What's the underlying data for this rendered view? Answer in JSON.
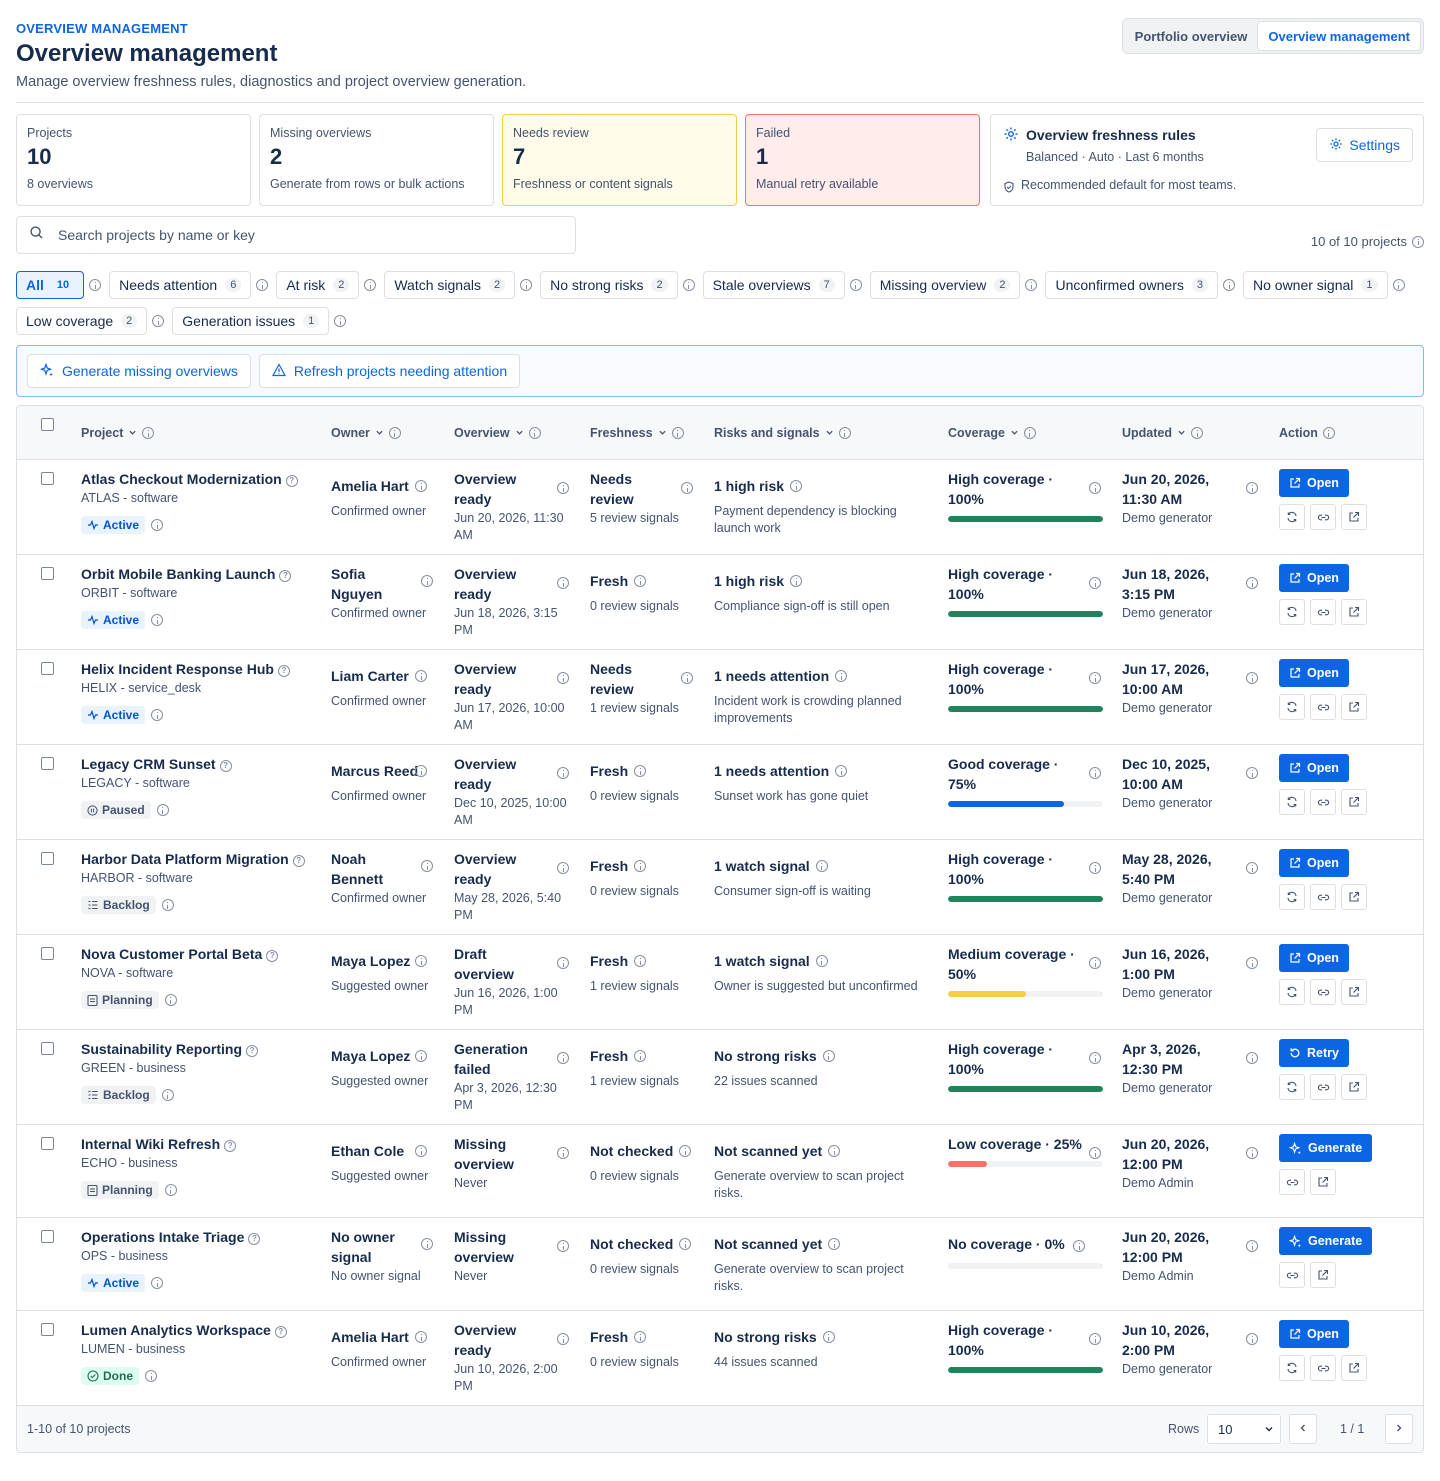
{
  "header": {
    "eyebrow": "OVERVIEW MANAGEMENT",
    "title": "Overview management",
    "subtitle": "Manage overview freshness rules, diagnostics and project overview generation.",
    "tabs": [
      "Portfolio overview",
      "Overview management"
    ],
    "active_tab": 1
  },
  "stats": [
    {
      "label": "Projects",
      "value": "10",
      "sub": "8 overviews"
    },
    {
      "label": "Missing overviews",
      "value": "2",
      "sub": "Generate from rows or bulk actions"
    },
    {
      "label": "Needs review",
      "value": "7",
      "sub": "Freshness or content signals"
    },
    {
      "label": "Failed",
      "value": "1",
      "sub": "Manual retry available"
    }
  ],
  "rules": {
    "title": "Overview freshness rules",
    "meta": "Balanced · Auto · Last 6 months",
    "note": "Recommended default for most teams.",
    "settings_label": "Settings"
  },
  "search": {
    "placeholder": "Search projects by name or key",
    "value": ""
  },
  "count_label": "10 of 10 projects",
  "filters": [
    {
      "label": "All",
      "count": "10"
    },
    {
      "label": "Needs attention",
      "count": "6"
    },
    {
      "label": "At risk",
      "count": "2"
    },
    {
      "label": "Watch signals",
      "count": "2"
    },
    {
      "label": "No strong risks",
      "count": "2"
    },
    {
      "label": "Stale overviews",
      "count": "7"
    },
    {
      "label": "Missing overview",
      "count": "2"
    },
    {
      "label": "Unconfirmed owners",
      "count": "3"
    },
    {
      "label": "No owner signal",
      "count": "1"
    },
    {
      "label": "Low coverage",
      "count": "2"
    },
    {
      "label": "Generation issues",
      "count": "1"
    }
  ],
  "bulk": {
    "generate_label": "Generate missing overviews",
    "refresh_label": "Refresh projects needing attention"
  },
  "columns": [
    "Project",
    "Owner",
    "Overview",
    "Freshness",
    "Risks and signals",
    "Coverage",
    "Updated",
    "Action"
  ],
  "rows": [
    {
      "name": "Atlas Checkout Modernization",
      "key": "ATLAS - software",
      "status": "Active",
      "owner": "Amelia Hart",
      "owner_sub": "Confirmed owner",
      "overview": "Overview ready",
      "overview_date": "Jun 20, 2026, 11:30 AM",
      "fresh": "Needs review",
      "fresh_sub": "5 review signals",
      "risk": "1 high risk",
      "risk_sub": "Payment dependency is blocking launch work",
      "cov": "High coverage · 100%",
      "cov_pct": 100,
      "cov_color": "#1f845a",
      "updated": "Jun 20, 2026, 11:30 AM",
      "updated_by": "Demo generator",
      "action": "Open"
    },
    {
      "name": "Orbit Mobile Banking Launch",
      "key": "ORBIT - software",
      "status": "Active",
      "owner": "Sofia Nguyen",
      "owner_sub": "Confirmed owner",
      "overview": "Overview ready",
      "overview_date": "Jun 18, 2026, 3:15 PM",
      "fresh": "Fresh",
      "fresh_sub": "0 review signals",
      "risk": "1 high risk",
      "risk_sub": "Compliance sign-off is still open",
      "cov": "High coverage · 100%",
      "cov_pct": 100,
      "cov_color": "#1f845a",
      "updated": "Jun 18, 2026, 3:15 PM",
      "updated_by": "Demo generator",
      "action": "Open"
    },
    {
      "name": "Helix Incident Response Hub",
      "key": "HELIX - service_desk",
      "status": "Active",
      "owner": "Liam Carter",
      "owner_sub": "Confirmed owner",
      "overview": "Overview ready",
      "overview_date": "Jun 17, 2026, 10:00 AM",
      "fresh": "Needs review",
      "fresh_sub": "1 review signals",
      "risk": "1 needs attention",
      "risk_sub": "Incident work is crowding planned improvements",
      "cov": "High coverage · 100%",
      "cov_pct": 100,
      "cov_color": "#1f845a",
      "updated": "Jun 17, 2026, 10:00 AM",
      "updated_by": "Demo generator",
      "action": "Open"
    },
    {
      "name": "Legacy CRM Sunset",
      "key": "LEGACY - software",
      "status": "Paused",
      "owner": "Marcus Reed",
      "owner_sub": "Confirmed owner",
      "overview": "Overview ready",
      "overview_date": "Dec 10, 2025, 10:00 AM",
      "fresh": "Fresh",
      "fresh_sub": "0 review signals",
      "risk": "1 needs attention",
      "risk_sub": "Sunset work has gone quiet",
      "cov": "Good coverage · 75%",
      "cov_pct": 75,
      "cov_color": "#0c66e4",
      "updated": "Dec 10, 2025, 10:00 AM",
      "updated_by": "Demo generator",
      "action": "Open"
    },
    {
      "name": "Harbor Data Platform Migration",
      "key": "HARBOR - software",
      "status": "Backlog",
      "owner": "Noah Bennett",
      "owner_sub": "Confirmed owner",
      "overview": "Overview ready",
      "overview_date": "May 28, 2026, 5:40 PM",
      "fresh": "Fresh",
      "fresh_sub": "0 review signals",
      "risk": "1 watch signal",
      "risk_sub": "Consumer sign-off is waiting",
      "cov": "High coverage · 100%",
      "cov_pct": 100,
      "cov_color": "#1f845a",
      "updated": "May 28, 2026, 5:40 PM",
      "updated_by": "Demo generator",
      "action": "Open"
    },
    {
      "name": "Nova Customer Portal Beta",
      "key": "NOVA - software",
      "status": "Planning",
      "owner": "Maya Lopez",
      "owner_sub": "Suggested owner",
      "overview": "Draft overview",
      "overview_date": "Jun 16, 2026, 1:00 PM",
      "fresh": "Fresh",
      "fresh_sub": "1 review signals",
      "risk": "1 watch signal",
      "risk_sub": "Owner is suggested but unconfirmed",
      "cov": "Medium coverage · 50%",
      "cov_pct": 50,
      "cov_color": "#f5cd47",
      "updated": "Jun 16, 2026, 1:00 PM",
      "updated_by": "Demo generator",
      "action": "Open"
    },
    {
      "name": "Sustainability Reporting",
      "key": "GREEN - business",
      "status": "Backlog",
      "owner": "Maya Lopez",
      "owner_sub": "Suggested owner",
      "overview": "Generation failed",
      "overview_date": "Apr 3, 2026, 12:30 PM",
      "fresh": "Fresh",
      "fresh_sub": "1 review signals",
      "risk": "No strong risks",
      "risk_sub": "22 issues scanned",
      "cov": "High coverage · 100%",
      "cov_pct": 100,
      "cov_color": "#1f845a",
      "updated": "Apr 3, 2026, 12:30 PM",
      "updated_by": "Demo generator",
      "action": "Retry"
    },
    {
      "name": "Internal Wiki Refresh",
      "key": "ECHO - business",
      "status": "Planning",
      "owner": "Ethan Cole",
      "owner_sub": "Suggested owner",
      "overview": "Missing overview",
      "overview_date": "Never",
      "fresh": "Not checked",
      "fresh_sub": "0 review signals",
      "risk": "Not scanned yet",
      "risk_sub": "Generate overview to scan project risks.",
      "cov": "Low coverage · 25%",
      "cov_pct": 25,
      "cov_color": "#f87168",
      "updated": "Jun 20, 2026, 12:00 PM",
      "updated_by": "Demo Admin",
      "action": "Generate"
    },
    {
      "name": "Operations Intake Triage",
      "key": "OPS - business",
      "status": "Active",
      "owner": "No owner signal",
      "owner_sub": "No owner signal",
      "overview": "Missing overview",
      "overview_date": "Never",
      "fresh": "Not checked",
      "fresh_sub": "0 review signals",
      "risk": "Not scanned yet",
      "risk_sub": "Generate overview to scan project risks.",
      "cov": "No coverage · 0%",
      "cov_pct": 0,
      "cov_color": "#8590a2",
      "updated": "Jun 20, 2026, 12:00 PM",
      "updated_by": "Demo Admin",
      "action": "Generate"
    },
    {
      "name": "Lumen Analytics Workspace",
      "key": "LUMEN - business",
      "status": "Done",
      "owner": "Amelia Hart",
      "owner_sub": "Confirmed owner",
      "overview": "Overview ready",
      "overview_date": "Jun 10, 2026, 2:00 PM",
      "fresh": "Fresh",
      "fresh_sub": "0 review signals",
      "risk": "No strong risks",
      "risk_sub": "44 issues scanned",
      "cov": "High coverage · 100%",
      "cov_pct": 100,
      "cov_color": "#1f845a",
      "updated": "Jun 10, 2026, 2:00 PM",
      "updated_by": "Demo generator",
      "action": "Open"
    }
  ],
  "footer": {
    "range": "1-10 of 10 projects",
    "rows_label": "Rows",
    "rows_value": "10",
    "page": "1 / 1"
  }
}
